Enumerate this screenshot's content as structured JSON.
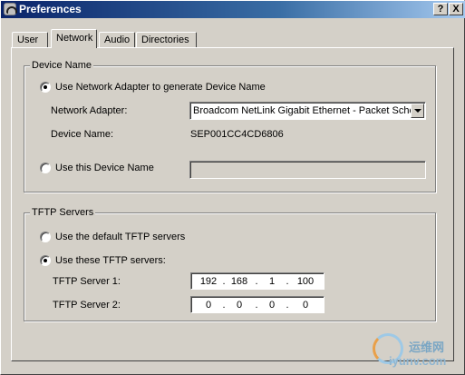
{
  "window": {
    "title": "Preferences",
    "help_label": "?",
    "close_label": "X"
  },
  "tabs": [
    {
      "label": "User",
      "active": false
    },
    {
      "label": "Network",
      "active": true
    },
    {
      "label": "Audio",
      "active": false
    },
    {
      "label": "Directories",
      "active": false
    }
  ],
  "device_name_group": {
    "legend": "Device Name",
    "use_adapter_radio": {
      "label": "Use Network Adapter to generate Device Name",
      "checked": true
    },
    "network_adapter_label": "Network Adapter:",
    "network_adapter_value": "Broadcom NetLink Gigabit Ethernet - Packet Schec",
    "device_name_label": "Device Name:",
    "device_name_value": "SEP001CC4CD6806",
    "use_this_radio": {
      "label": "Use this Device Name",
      "checked": false
    },
    "device_name_input_value": ""
  },
  "tftp_group": {
    "legend": "TFTP Servers",
    "default_radio": {
      "label": "Use the default TFTP servers",
      "checked": false
    },
    "these_radio": {
      "label": "Use these TFTP servers:",
      "checked": true
    },
    "server1_label": "TFTP Server 1:",
    "server1": [
      "192",
      "168",
      "1",
      "100"
    ],
    "server2_label": "TFTP Server 2:",
    "server2": [
      "0",
      "0",
      "0",
      "0"
    ]
  },
  "watermark": {
    "cn": "运维网",
    "en": "iyunv.com"
  }
}
